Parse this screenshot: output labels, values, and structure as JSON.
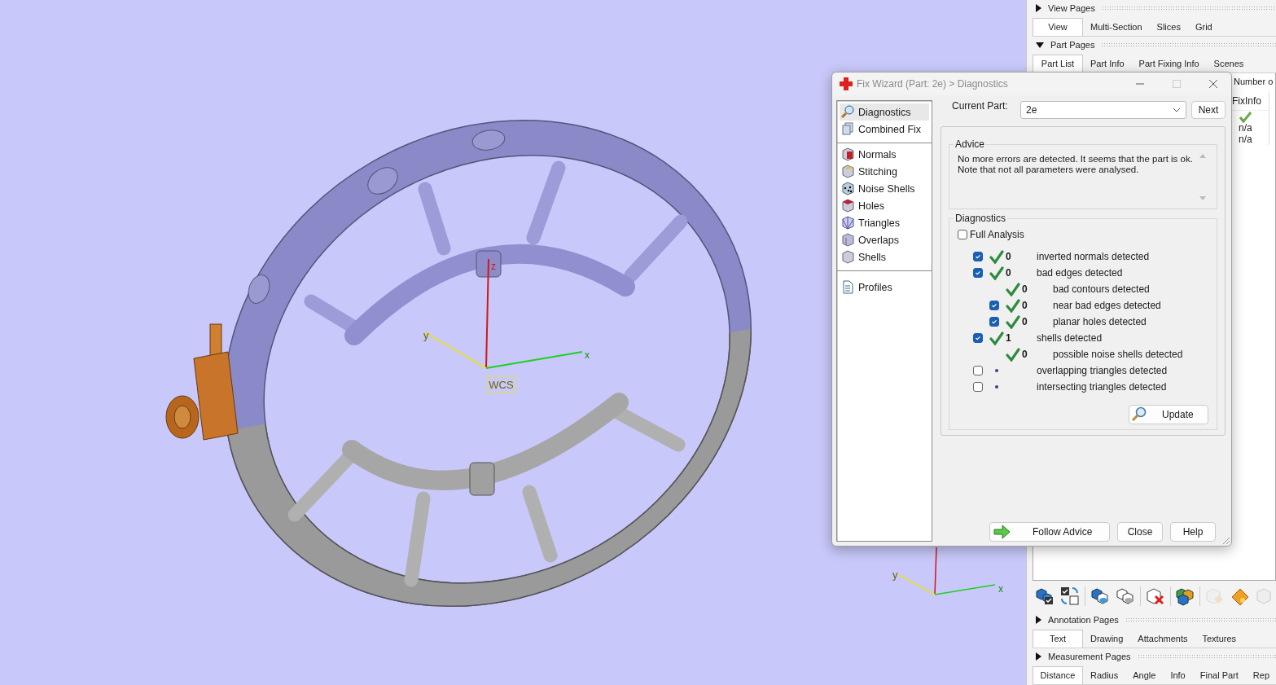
{
  "viewport": {
    "triad": {
      "z": "z",
      "x": "x",
      "y": "y",
      "label": "WCS"
    },
    "mini_triad": {
      "x": "x",
      "y": "y"
    }
  },
  "side_panel": {
    "sections": [
      {
        "title": "View Pages",
        "expanded": false,
        "tabs": [
          {
            "label": "View",
            "selected": true
          },
          {
            "label": "Multi-Section",
            "selected": false
          },
          {
            "label": "Slices",
            "selected": false
          },
          {
            "label": "Grid",
            "selected": false
          }
        ]
      },
      {
        "title": "Part Pages",
        "expanded": true,
        "tabs": [
          {
            "label": "Part List",
            "selected": true
          },
          {
            "label": "Part Info",
            "selected": false
          },
          {
            "label": "Part Fixing Info",
            "selected": false
          },
          {
            "label": "Scenes",
            "selected": false
          }
        ],
        "part_list": {
          "header": "Number o",
          "column": "FixInfo",
          "rows": [
            {
              "kind": "check"
            },
            {
              "kind": "text",
              "text": "n/a"
            },
            {
              "kind": "text",
              "text": "n/a"
            }
          ]
        },
        "toolbar": [
          {
            "disabled": false
          },
          {
            "disabled": false
          },
          {
            "disabled": false
          },
          {
            "disabled": false
          },
          {
            "disabled": false
          },
          {
            "disabled": false
          },
          {
            "disabled": true
          },
          {
            "disabled": false
          },
          {
            "disabled": true
          }
        ]
      },
      {
        "title": "Annotation Pages",
        "expanded": false,
        "tabs": [
          {
            "label": "Text",
            "selected": true
          },
          {
            "label": "Drawing",
            "selected": false
          },
          {
            "label": "Attachments",
            "selected": false
          },
          {
            "label": "Textures",
            "selected": false
          }
        ]
      },
      {
        "title": "Measurement Pages",
        "expanded": false,
        "tabs": [
          {
            "label": "Distance",
            "selected": true
          },
          {
            "label": "Radius",
            "selected": false
          },
          {
            "label": "Angle",
            "selected": false
          },
          {
            "label": "Info",
            "selected": false
          },
          {
            "label": "Final Part",
            "selected": false
          },
          {
            "label": "Rep",
            "selected": false
          }
        ]
      }
    ]
  },
  "dialog": {
    "title": "Fix Wizard (Part: 2e) > Diagnostics",
    "nav_groups": [
      [
        {
          "label": "Diagnostics",
          "selected": true
        },
        {
          "label": "Combined Fix",
          "selected": false
        }
      ],
      [
        {
          "label": "Normals",
          "selected": false
        },
        {
          "label": "Stitching",
          "selected": false
        },
        {
          "label": "Noise Shells",
          "selected": false
        },
        {
          "label": "Holes",
          "selected": false
        },
        {
          "label": "Triangles",
          "selected": false
        },
        {
          "label": "Overlaps",
          "selected": false
        },
        {
          "label": "Shells",
          "selected": false
        }
      ],
      [
        {
          "label": "Profiles",
          "selected": false
        }
      ]
    ],
    "current_part": {
      "label": "Current Part:",
      "value": "2e"
    },
    "next_button": "Next",
    "advice": {
      "title": "Advice",
      "text": "No more errors are detected. It seems that the part is ok.\nNote that not all parameters were analysed."
    },
    "diagnostics": {
      "title": "Diagnostics",
      "full_analysis": {
        "label": "Full Analysis",
        "checked": false
      },
      "checks": [
        {
          "checked": true,
          "passed": true,
          "count": "0",
          "label": "inverted normals detected"
        },
        {
          "checked": true,
          "passed": true,
          "count": "0",
          "label": "bad edges detected",
          "children": [
            {
              "passed": true,
              "count": "0",
              "label": "bad contours detected"
            },
            {
              "checked": true,
              "passed": true,
              "count": "0",
              "label": "near bad edges detected"
            },
            {
              "checked": true,
              "passed": true,
              "count": "0",
              "label": "planar holes detected"
            }
          ]
        },
        {
          "checked": true,
          "passed": true,
          "count": "1",
          "label": "shells detected",
          "children": [
            {
              "passed": true,
              "count": "0",
              "label": "possible noise shells detected"
            }
          ]
        },
        {
          "checked": false,
          "passed": false,
          "label": "overlapping triangles detected"
        },
        {
          "checked": false,
          "passed": false,
          "label": "intersecting triangles detected"
        }
      ],
      "update_button": "Update"
    },
    "buttons": [
      {
        "label": "Follow Advice",
        "kind": "follow"
      },
      {
        "label": "Close",
        "kind": "plain"
      },
      {
        "label": "Help",
        "kind": "plain"
      }
    ]
  }
}
